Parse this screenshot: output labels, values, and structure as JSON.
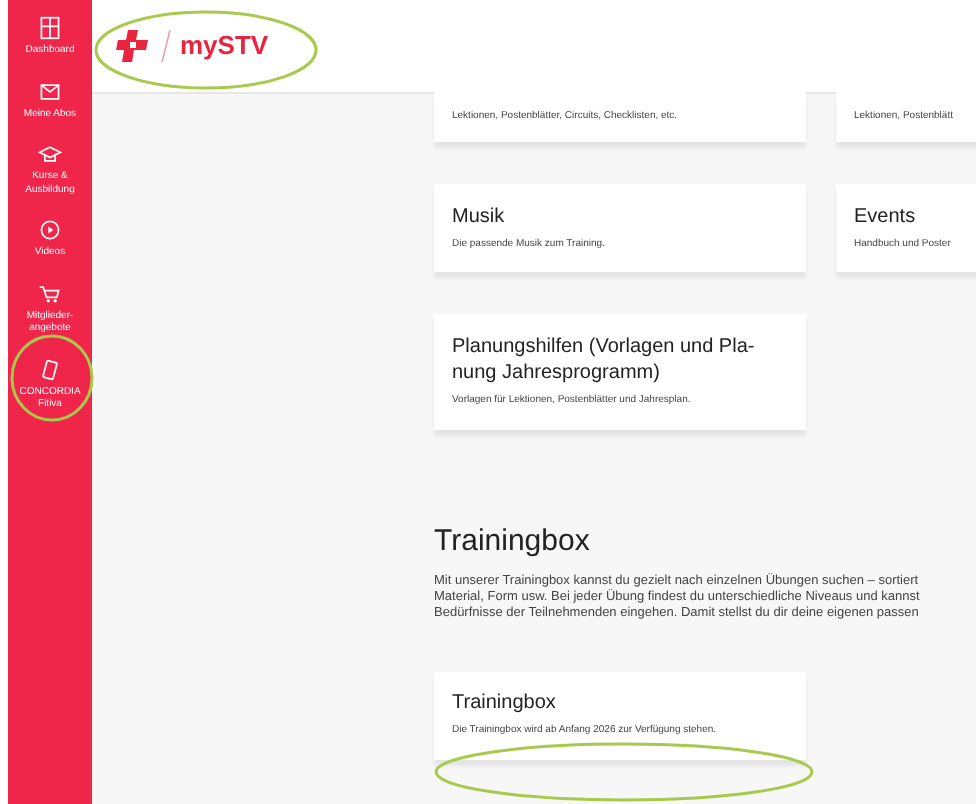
{
  "sidebar": {
    "items": [
      {
        "label": "Dashboard",
        "kind": "dashboard"
      },
      {
        "label": "Meine Abos",
        "kind": "mail"
      },
      {
        "label": "Kurse & Ausbildung",
        "kind": "cap"
      },
      {
        "label": "Videos",
        "kind": "play"
      },
      {
        "label": "Mitglieder-angebote",
        "kind": "cart"
      },
      {
        "label": "CONCORDIA Fitiva",
        "kind": "phone"
      }
    ]
  },
  "header": {
    "logo_text": "mySTV"
  },
  "top_cards": [
    {
      "description": "Lektionen, Postenblätter, Circuits, Checklisten, etc."
    },
    {
      "description": "Lektionen, Postenblätt"
    }
  ],
  "cards": [
    {
      "title": "Musik",
      "description": "Die passende Musik zum Training."
    },
    {
      "title": "Events",
      "description": "Handbuch und Poster"
    },
    {
      "title": "Planungshilfen (Vorlagen und Pla-\nnung Jahresprogramm)",
      "description": "Vorlagen für Lektionen, Postenblätter und Jahresplan."
    }
  ],
  "trainingbox": {
    "heading": "Trainingbox",
    "paragraph": "Mit unserer Trainingbox kannst du gezielt nach einzelnen Übungen suchen – sortiert\nMaterial, Form usw. Bei jeder Übung findest du unterschiedliche Niveaus und kannst\nBedürfnisse der Teilnehmenden eingehen. Damit stellst du dir deine eigenen passen",
    "card": {
      "title": "Trainingbox",
      "description": "Die Trainingbox wird ab Anfang 2026 zur Verfügung stehen."
    }
  }
}
